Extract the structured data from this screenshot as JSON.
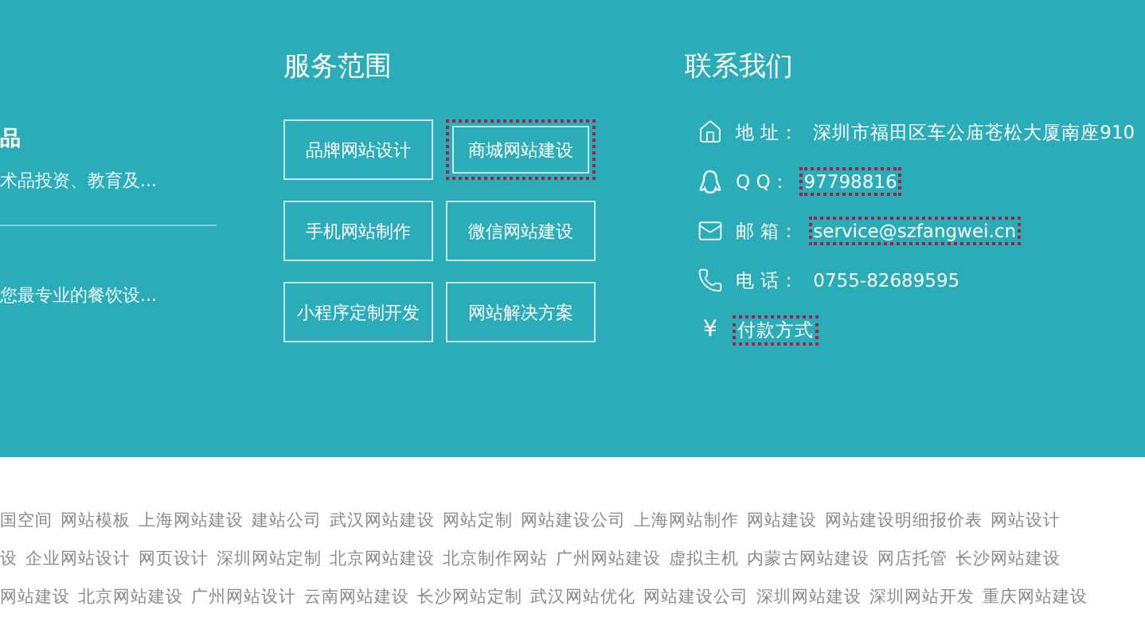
{
  "left_column": {
    "title": "品",
    "items": [
      {
        "text": "术品投资、教育及..."
      },
      {
        "text": "您最专业的餐饮设..."
      }
    ]
  },
  "services": {
    "title": "服务范围",
    "items": [
      {
        "label": "品牌网站设计",
        "outlined": false
      },
      {
        "label": "商城网站建设",
        "outlined": true
      },
      {
        "label": "手机网站制作",
        "outlined": false
      },
      {
        "label": "微信网站建设",
        "outlined": false
      },
      {
        "label": "小程序定制开发",
        "outlined": false
      },
      {
        "label": "网站解决方案",
        "outlined": false
      }
    ]
  },
  "contact": {
    "title": "联系我们",
    "rows": [
      {
        "kind": "address",
        "label": "地 址：",
        "value": "深圳市福田区车公庙苍松大厦南座910",
        "outlined": false
      },
      {
        "kind": "qq",
        "label": "Q Q：",
        "value": "97798816",
        "outlined": true
      },
      {
        "kind": "email",
        "label": "邮 箱：",
        "value": "service@szfangwei.cn",
        "outlined": true
      },
      {
        "kind": "phone",
        "label": "电 话：",
        "value": "0755-82689595",
        "outlined": false
      },
      {
        "kind": "payment",
        "icon": "¥",
        "value": "付款方式",
        "outlined": true
      }
    ]
  },
  "links": [
    [
      "国空间",
      "网站模板",
      "上海网站建设",
      "建站公司",
      "武汉网站建设",
      "网站定制",
      "网站建设公司",
      "上海网站制作",
      "网站建设",
      "网站建设明细报价表",
      "网站设计"
    ],
    [
      "设",
      "企业网站设计",
      "网页设计",
      "深圳网站定制",
      "北京网站建设",
      "北京制作网站",
      "广州网站建设",
      "虚拟主机",
      "内蒙古网站建设",
      "网店托管",
      "长沙网站建设"
    ],
    [
      "网站建设",
      "北京网站建设",
      "广州网站设计",
      "云南网站建设",
      "长沙网站定制",
      "武汉网站优化",
      "网站建设公司",
      "深圳网站建设",
      "深圳网站开发",
      "重庆网站建设"
    ]
  ]
}
